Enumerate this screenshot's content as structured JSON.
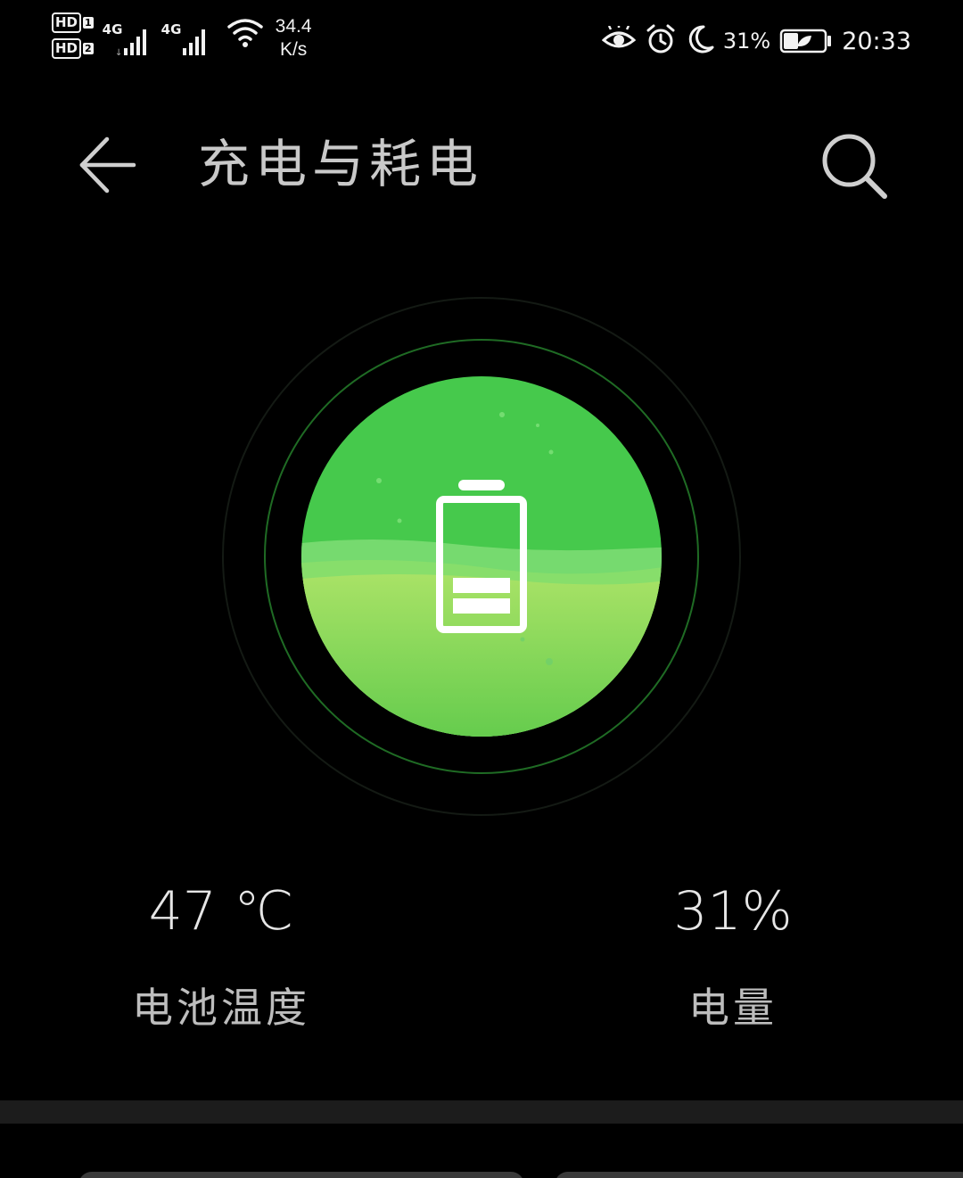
{
  "status_bar": {
    "sim1_label": "HD",
    "sim1_index": "1",
    "sim2_label": "HD",
    "sim2_index": "2",
    "network1": "4G",
    "network2": "4G",
    "speed_value": "34.4",
    "speed_unit": "K/s",
    "battery_percent": "31%",
    "time": "20:33",
    "icons": [
      "eye-comfort-icon",
      "alarm-icon",
      "do-not-disturb-icon",
      "power-saving-battery-icon"
    ]
  },
  "header": {
    "title": "充电与耗电",
    "back_icon": "arrow-left-icon",
    "search_icon": "search-icon"
  },
  "battery_visual": {
    "level_percent": 31,
    "colors": {
      "top_fill": "#46c94c",
      "bottom_fill": "#a6e063",
      "ring": "#1f6b24"
    }
  },
  "stats": {
    "temperature_value": "47 ℃",
    "temperature_label": "电池温度",
    "level_value": "31%",
    "level_label": "电量"
  }
}
